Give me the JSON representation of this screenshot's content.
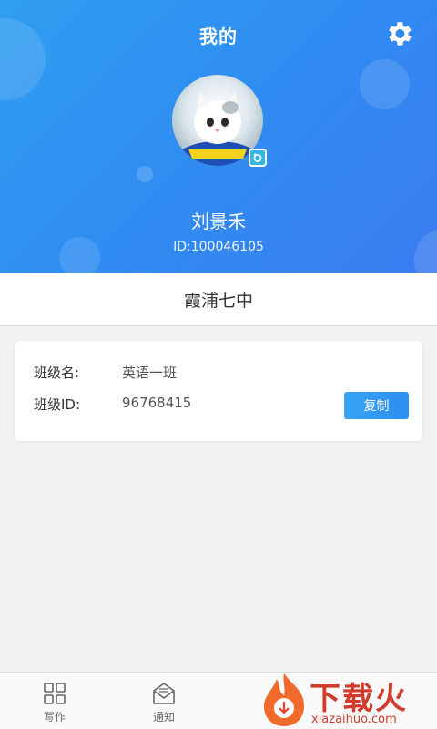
{
  "header": {
    "title": "我的",
    "username": "刘景禾",
    "user_id": "ID:100046105",
    "gradient": [
      "#2f9ef0",
      "#3a7cf0"
    ]
  },
  "icons": {
    "settings": "gear-icon",
    "avatar_badge": "camera-icon",
    "write": "grid-icon",
    "notice": "mail-icon"
  },
  "school": {
    "name": "霞浦七中"
  },
  "class_info": {
    "name_label": "班级名:",
    "name_value": "英语一班",
    "id_label": "班级ID:",
    "id_value": "96768415",
    "copy_label": "复制"
  },
  "bottom_nav": {
    "items": [
      {
        "label": "写作"
      },
      {
        "label": "通知"
      }
    ]
  },
  "watermark": {
    "brand": "下载火",
    "domain": "xiazaihuo.com"
  },
  "colors": {
    "accent": "#2f8ef2",
    "watermark": "#d23a2b"
  }
}
